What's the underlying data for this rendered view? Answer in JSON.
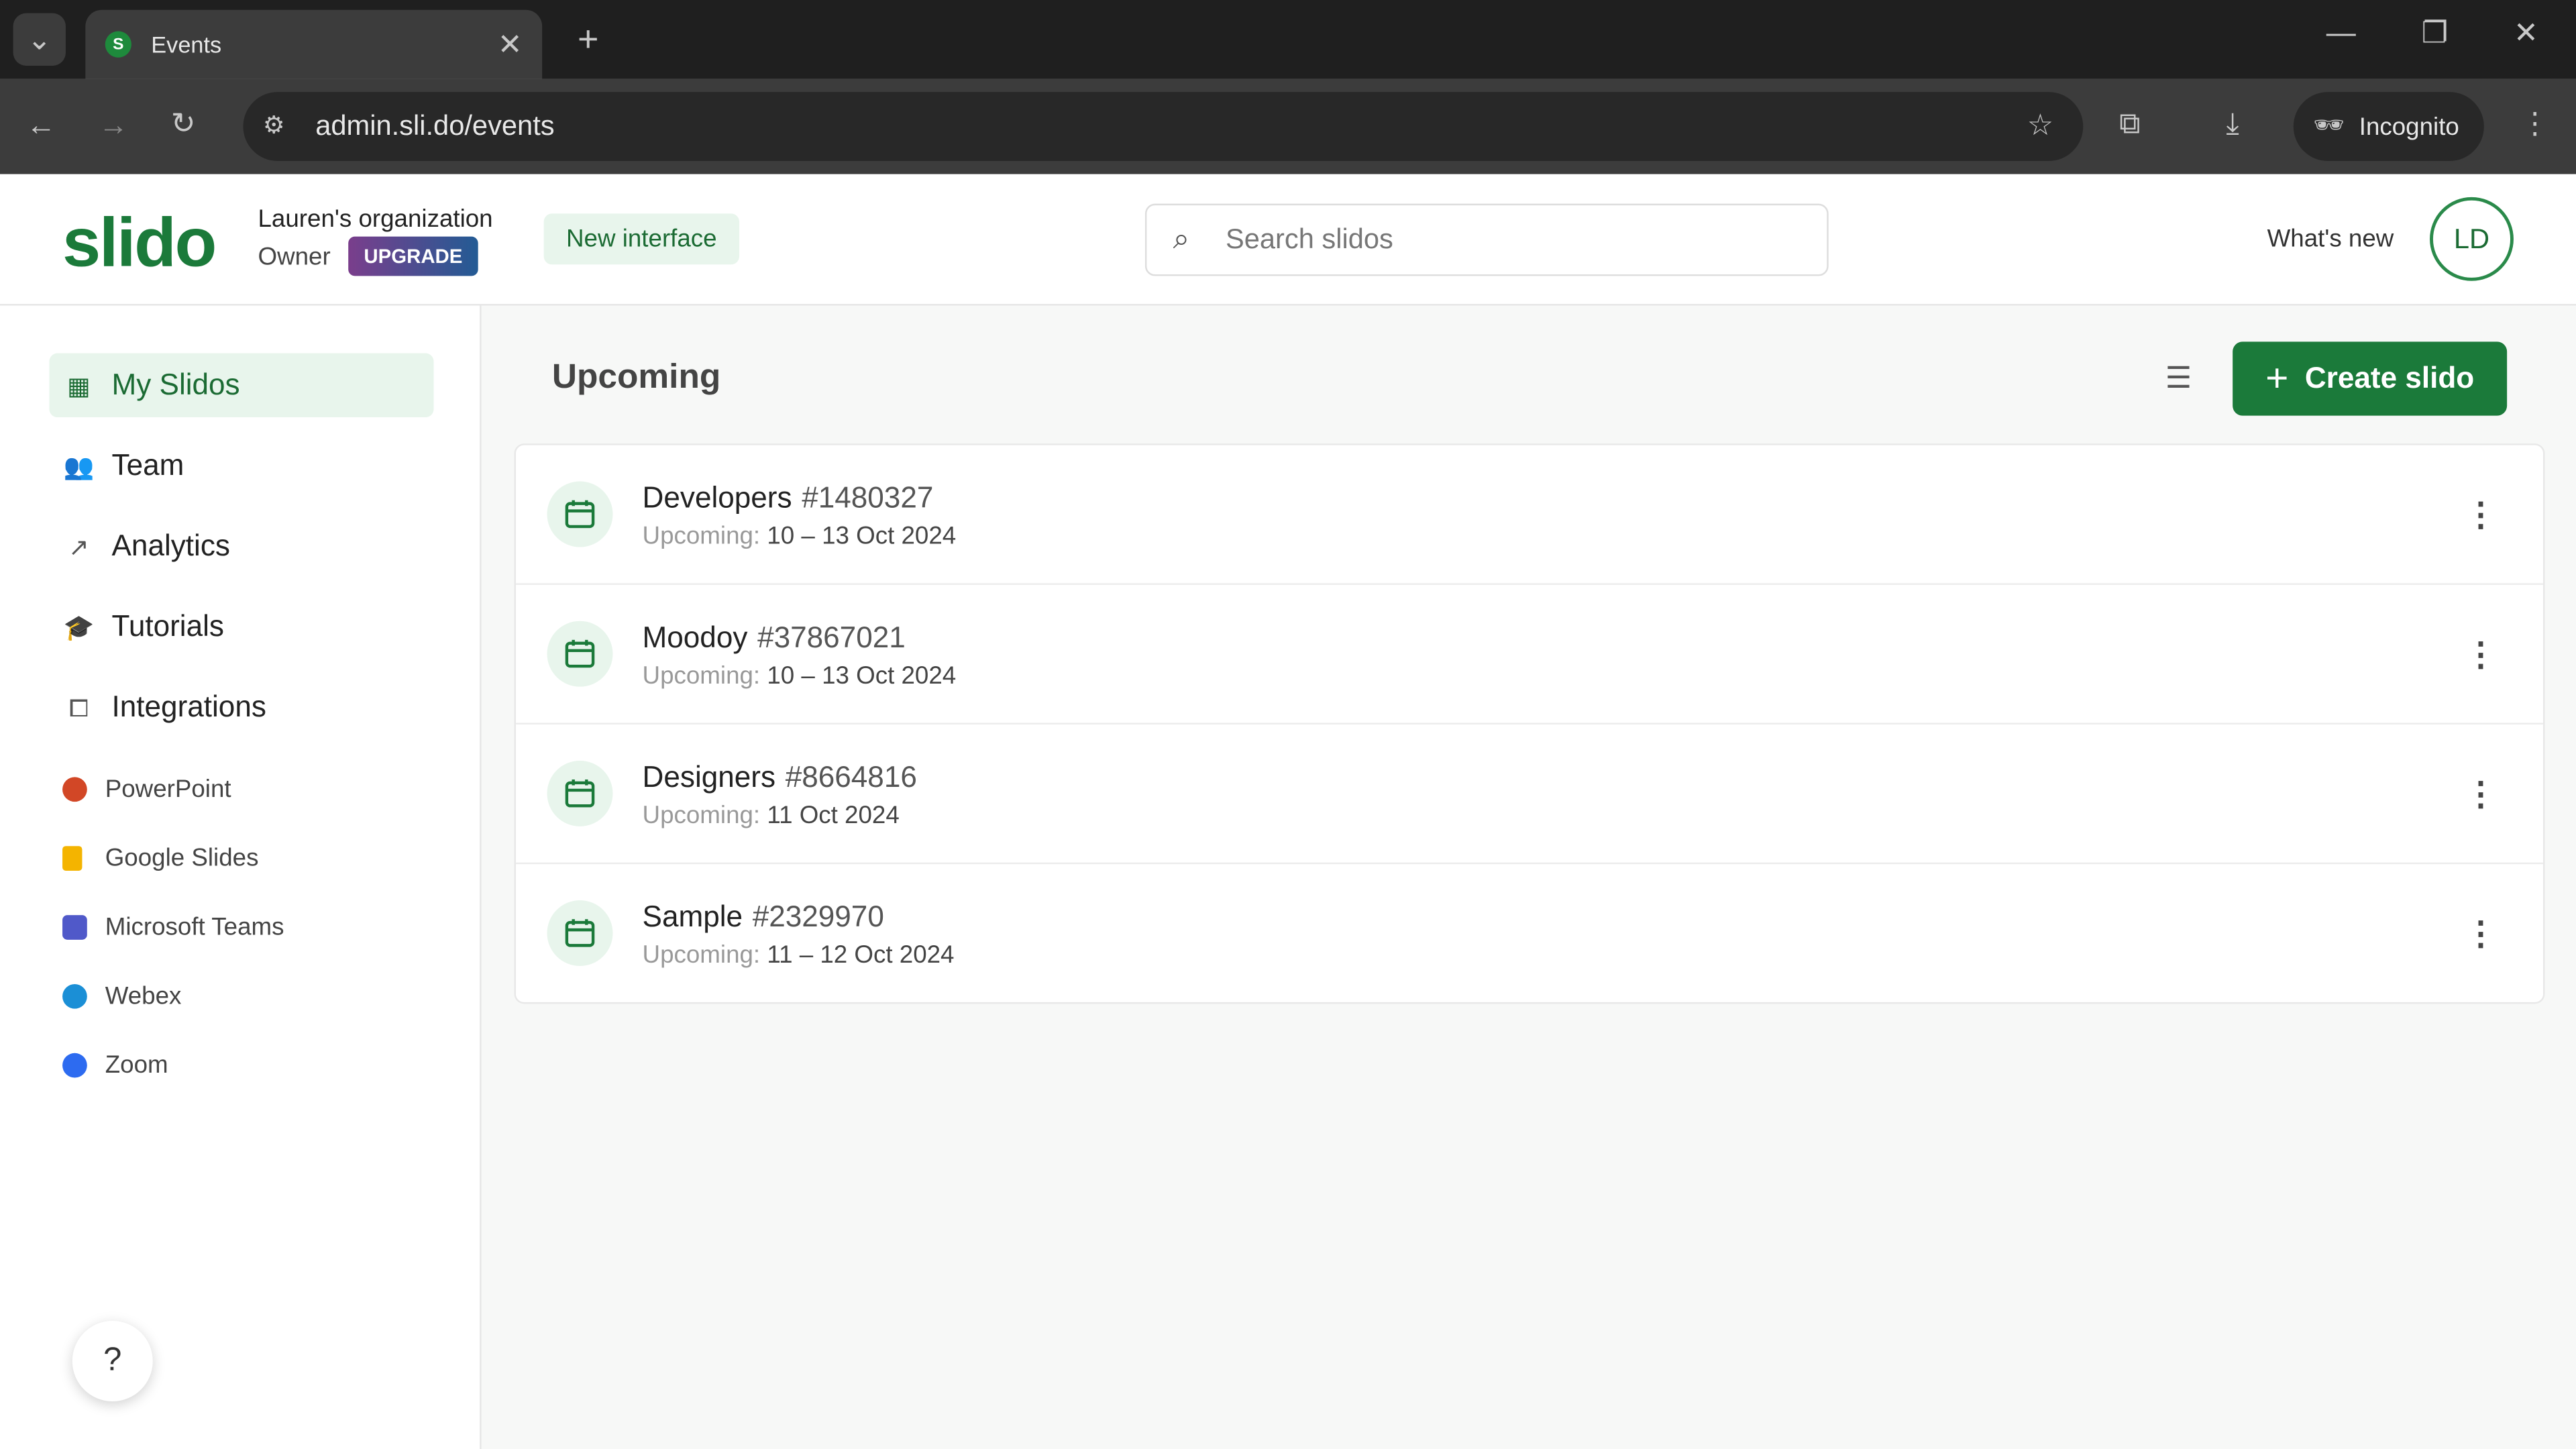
{
  "browser": {
    "tab_title": "Events",
    "tab_favicon": "S",
    "url": "admin.sli.do/events",
    "incognito_label": "Incognito"
  },
  "header": {
    "logo": "slido",
    "org_name": "Lauren's organization",
    "role": "Owner",
    "upgrade_label": "UPGRADE",
    "new_interface_label": "New interface",
    "search_placeholder": "Search slidos",
    "whats_new": "What's new",
    "avatar_initials": "LD"
  },
  "sidebar": {
    "items": [
      {
        "label": "My Slidos",
        "icon": "calendar-grid-icon",
        "active": true
      },
      {
        "label": "Team",
        "icon": "people-icon"
      },
      {
        "label": "Analytics",
        "icon": "trend-icon"
      },
      {
        "label": "Tutorials",
        "icon": "graduation-cap-icon"
      },
      {
        "label": "Integrations",
        "icon": "puzzle-icon"
      }
    ],
    "integrations": [
      {
        "label": "PowerPoint",
        "color": "#d24726"
      },
      {
        "label": "Google Slides",
        "color": "#f4b400"
      },
      {
        "label": "Microsoft Teams",
        "color": "#5059c9"
      },
      {
        "label": "Webex",
        "color": "#1b8fd6"
      },
      {
        "label": "Zoom",
        "color": "#2d6bf0"
      }
    ],
    "help": "?"
  },
  "main": {
    "title": "Upcoming",
    "create_label": "Create slido",
    "events": [
      {
        "name": "Developers",
        "code": "#1480327",
        "status": "Upcoming:",
        "dates": "10 – 13 Oct 2024"
      },
      {
        "name": "Moodoy",
        "code": "#37867021",
        "status": "Upcoming:",
        "dates": "10 – 13 Oct 2024"
      },
      {
        "name": "Designers",
        "code": "#8664816",
        "status": "Upcoming:",
        "dates": "11 Oct 2024"
      },
      {
        "name": "Sample",
        "code": "#2329970",
        "status": "Upcoming:",
        "dates": "11 – 12 Oct 2024"
      }
    ]
  },
  "colors": {
    "brand": "#1b7a3a",
    "brand_light": "#e8f5ec"
  }
}
